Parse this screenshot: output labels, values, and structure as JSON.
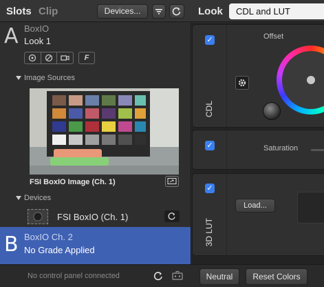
{
  "topbar": {
    "tab_slots": "Slots",
    "tab_clip": "Clip",
    "devices_label": "Devices...",
    "look_label": "Look",
    "look_value": "CDL and LUT"
  },
  "slot_a": {
    "letter": "A",
    "device": "BoxIO",
    "look": "Look 1",
    "f_label": "F"
  },
  "image_sources": {
    "header": "Image Sources",
    "caption": "FSI BoxIO Image (Ch. 1)"
  },
  "devices": {
    "header": "Devices",
    "name": "FSI BoxIO (Ch. 1)"
  },
  "slot_b": {
    "letter": "B",
    "device": "BoxIO Ch. 2",
    "status": "No Grade Applied"
  },
  "bottom": {
    "status": "No control panel connected",
    "neutral_label": "Neutral",
    "reset_label": "Reset Colors"
  },
  "cdl_card": {
    "label": "CDL",
    "offset_label": "Offset",
    "checked": true
  },
  "sat_card": {
    "saturation_label": "Saturation",
    "checked": true
  },
  "lut_card": {
    "label": "3D LUT",
    "load_label": "Load...",
    "checked": true
  },
  "colors": {
    "accent": "#3a7ff0",
    "selected_slot": "#3f61b3"
  }
}
